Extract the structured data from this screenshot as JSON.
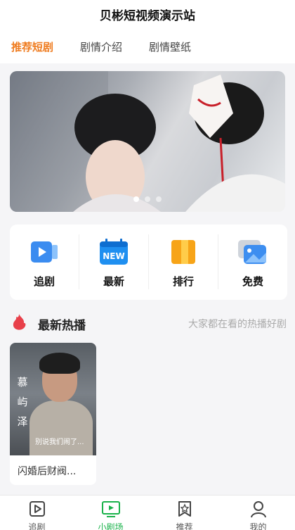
{
  "app": {
    "title": "贝彬短视频演示站"
  },
  "tabs": [
    {
      "label": "推荐短剧",
      "active": true
    },
    {
      "label": "剧情介绍",
      "active": false
    },
    {
      "label": "剧情壁纸",
      "active": false
    }
  ],
  "banner": {
    "slide_count": 3,
    "current": 1
  },
  "quick_actions": [
    {
      "label": "追剧",
      "icon": "play-video-icon"
    },
    {
      "label": "最新",
      "icon": "new-calendar-icon",
      "badge": "NEW"
    },
    {
      "label": "排行",
      "icon": "ranking-icon"
    },
    {
      "label": "免费",
      "icon": "gallery-icon"
    }
  ],
  "section": {
    "title": "最新热播",
    "subtitle": "大家都在看的热播好剧",
    "icon": "flame-icon"
  },
  "dramas": [
    {
      "title": "闪婚后财阀...",
      "poster_name_vertical": "慕屿泽",
      "poster_subtitle": "别说我们闹了..."
    }
  ],
  "bottom_nav": [
    {
      "label": "追剧",
      "icon": "play-square-icon",
      "active": false
    },
    {
      "label": "小剧场",
      "icon": "tv-icon",
      "active": true
    },
    {
      "label": "推荐",
      "icon": "star-bookmark-icon",
      "active": false
    },
    {
      "label": "我的",
      "icon": "user-icon",
      "active": false
    }
  ],
  "colors": {
    "accent": "#ef7d22",
    "nav_active": "#19b24a",
    "background": "#f5f5f7"
  }
}
